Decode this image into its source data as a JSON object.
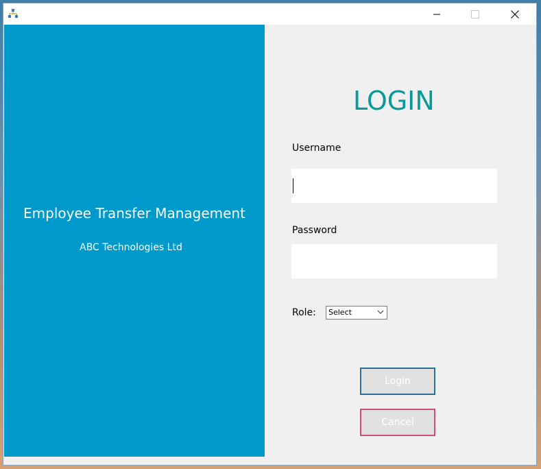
{
  "window": {
    "minimize_icon": "minimize-icon",
    "maximize_icon": "maximize-icon",
    "close_icon": "close-icon",
    "app_icon": "app-network-icon"
  },
  "left_panel": {
    "app_title": "Employee Transfer Management",
    "company": "ABC Technologies Ltd",
    "color": "#0099cc"
  },
  "form": {
    "heading": "LOGIN",
    "heading_color": "#0a9999",
    "username_label": "Username",
    "username_value": "",
    "password_label": "Password",
    "password_value": "",
    "role_label": "Role:",
    "role_selected": "Select",
    "login_label": "Login",
    "cancel_label": "Cancel"
  }
}
